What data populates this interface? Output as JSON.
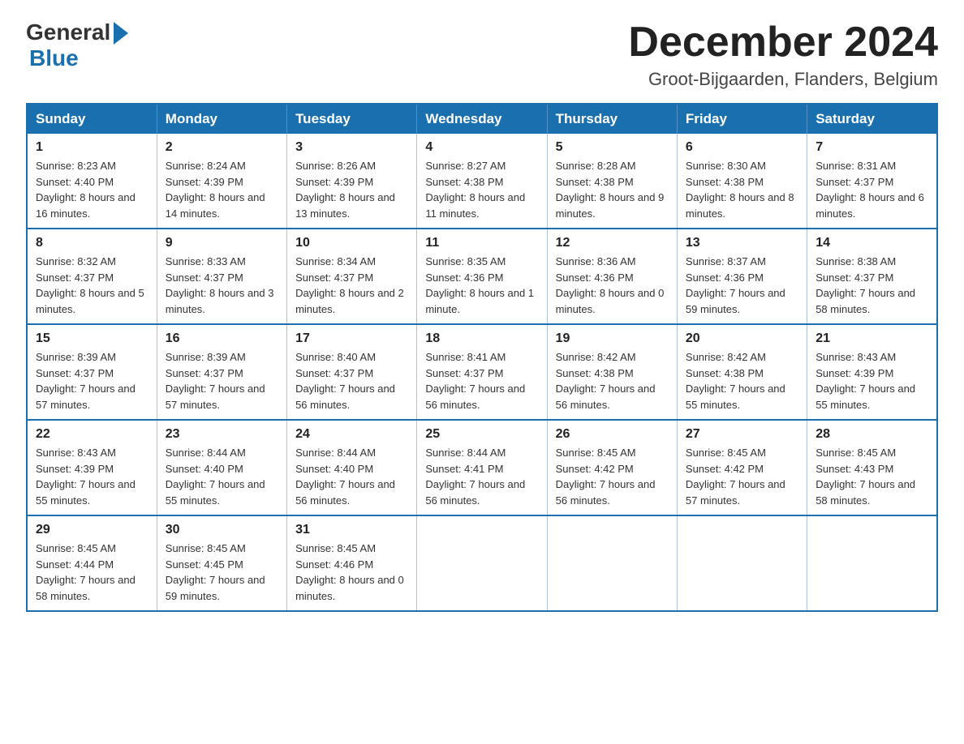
{
  "logo": {
    "general": "General",
    "blue": "Blue"
  },
  "title": "December 2024",
  "subtitle": "Groot-Bijgaarden, Flanders, Belgium",
  "weekdays": [
    "Sunday",
    "Monday",
    "Tuesday",
    "Wednesday",
    "Thursday",
    "Friday",
    "Saturday"
  ],
  "weeks": [
    [
      {
        "day": "1",
        "sunrise": "8:23 AM",
        "sunset": "4:40 PM",
        "daylight": "8 hours and 16 minutes."
      },
      {
        "day": "2",
        "sunrise": "8:24 AM",
        "sunset": "4:39 PM",
        "daylight": "8 hours and 14 minutes."
      },
      {
        "day": "3",
        "sunrise": "8:26 AM",
        "sunset": "4:39 PM",
        "daylight": "8 hours and 13 minutes."
      },
      {
        "day": "4",
        "sunrise": "8:27 AM",
        "sunset": "4:38 PM",
        "daylight": "8 hours and 11 minutes."
      },
      {
        "day": "5",
        "sunrise": "8:28 AM",
        "sunset": "4:38 PM",
        "daylight": "8 hours and 9 minutes."
      },
      {
        "day": "6",
        "sunrise": "8:30 AM",
        "sunset": "4:38 PM",
        "daylight": "8 hours and 8 minutes."
      },
      {
        "day": "7",
        "sunrise": "8:31 AM",
        "sunset": "4:37 PM",
        "daylight": "8 hours and 6 minutes."
      }
    ],
    [
      {
        "day": "8",
        "sunrise": "8:32 AM",
        "sunset": "4:37 PM",
        "daylight": "8 hours and 5 minutes."
      },
      {
        "day": "9",
        "sunrise": "8:33 AM",
        "sunset": "4:37 PM",
        "daylight": "8 hours and 3 minutes."
      },
      {
        "day": "10",
        "sunrise": "8:34 AM",
        "sunset": "4:37 PM",
        "daylight": "8 hours and 2 minutes."
      },
      {
        "day": "11",
        "sunrise": "8:35 AM",
        "sunset": "4:36 PM",
        "daylight": "8 hours and 1 minute."
      },
      {
        "day": "12",
        "sunrise": "8:36 AM",
        "sunset": "4:36 PM",
        "daylight": "8 hours and 0 minutes."
      },
      {
        "day": "13",
        "sunrise": "8:37 AM",
        "sunset": "4:36 PM",
        "daylight": "7 hours and 59 minutes."
      },
      {
        "day": "14",
        "sunrise": "8:38 AM",
        "sunset": "4:37 PM",
        "daylight": "7 hours and 58 minutes."
      }
    ],
    [
      {
        "day": "15",
        "sunrise": "8:39 AM",
        "sunset": "4:37 PM",
        "daylight": "7 hours and 57 minutes."
      },
      {
        "day": "16",
        "sunrise": "8:39 AM",
        "sunset": "4:37 PM",
        "daylight": "7 hours and 57 minutes."
      },
      {
        "day": "17",
        "sunrise": "8:40 AM",
        "sunset": "4:37 PM",
        "daylight": "7 hours and 56 minutes."
      },
      {
        "day": "18",
        "sunrise": "8:41 AM",
        "sunset": "4:37 PM",
        "daylight": "7 hours and 56 minutes."
      },
      {
        "day": "19",
        "sunrise": "8:42 AM",
        "sunset": "4:38 PM",
        "daylight": "7 hours and 56 minutes."
      },
      {
        "day": "20",
        "sunrise": "8:42 AM",
        "sunset": "4:38 PM",
        "daylight": "7 hours and 55 minutes."
      },
      {
        "day": "21",
        "sunrise": "8:43 AM",
        "sunset": "4:39 PM",
        "daylight": "7 hours and 55 minutes."
      }
    ],
    [
      {
        "day": "22",
        "sunrise": "8:43 AM",
        "sunset": "4:39 PM",
        "daylight": "7 hours and 55 minutes."
      },
      {
        "day": "23",
        "sunrise": "8:44 AM",
        "sunset": "4:40 PM",
        "daylight": "7 hours and 55 minutes."
      },
      {
        "day": "24",
        "sunrise": "8:44 AM",
        "sunset": "4:40 PM",
        "daylight": "7 hours and 56 minutes."
      },
      {
        "day": "25",
        "sunrise": "8:44 AM",
        "sunset": "4:41 PM",
        "daylight": "7 hours and 56 minutes."
      },
      {
        "day": "26",
        "sunrise": "8:45 AM",
        "sunset": "4:42 PM",
        "daylight": "7 hours and 56 minutes."
      },
      {
        "day": "27",
        "sunrise": "8:45 AM",
        "sunset": "4:42 PM",
        "daylight": "7 hours and 57 minutes."
      },
      {
        "day": "28",
        "sunrise": "8:45 AM",
        "sunset": "4:43 PM",
        "daylight": "7 hours and 58 minutes."
      }
    ],
    [
      {
        "day": "29",
        "sunrise": "8:45 AM",
        "sunset": "4:44 PM",
        "daylight": "7 hours and 58 minutes."
      },
      {
        "day": "30",
        "sunrise": "8:45 AM",
        "sunset": "4:45 PM",
        "daylight": "7 hours and 59 minutes."
      },
      {
        "day": "31",
        "sunrise": "8:45 AM",
        "sunset": "4:46 PM",
        "daylight": "8 hours and 0 minutes."
      },
      null,
      null,
      null,
      null
    ]
  ]
}
